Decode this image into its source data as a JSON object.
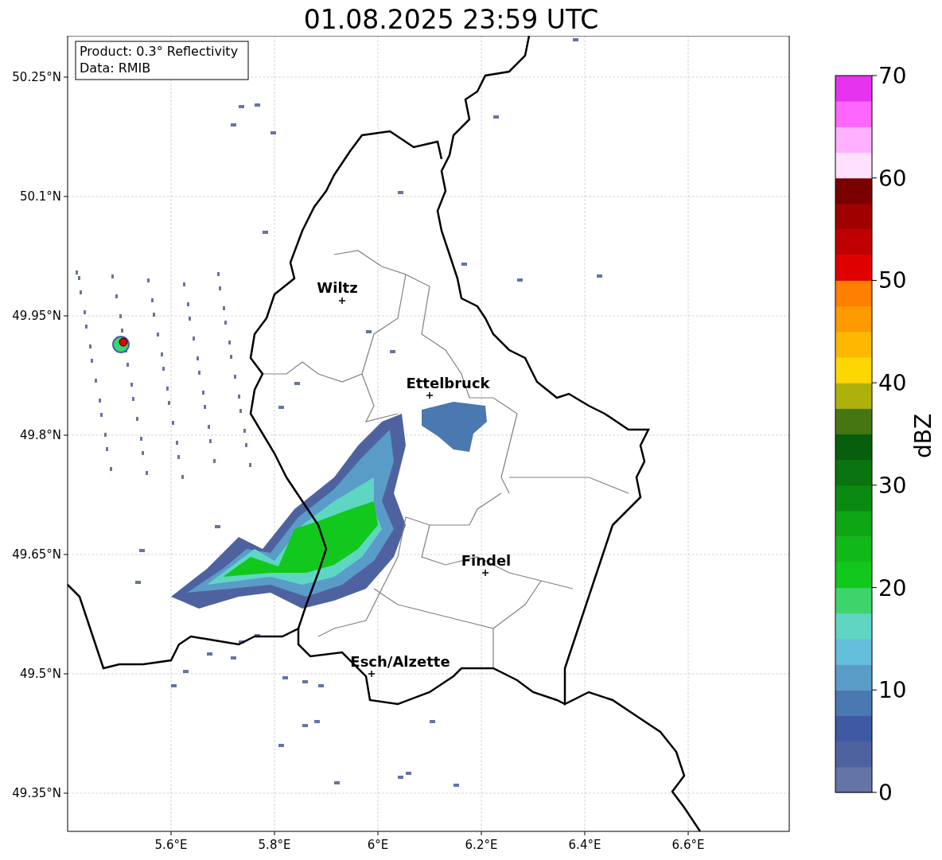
{
  "title": "01.08.2025 23:59 UTC",
  "info_box": {
    "product": "Product: 0.3° Reflectivity",
    "data": "Data: RMIB"
  },
  "y_ticks": [
    "50.25°N",
    "50.1°N",
    "49.95°N",
    "49.8°N",
    "49.65°N",
    "49.5°N",
    "49.35°N"
  ],
  "x_ticks": [
    "5.6°E",
    "5.8°E",
    "6°E",
    "6.2°E",
    "6.4°E",
    "6.6°E"
  ],
  "cities": [
    "Wiltz",
    "Ettelbruck",
    "Findel",
    "Esch/Alzette"
  ],
  "colorbar": {
    "label": "dBZ",
    "ticks": [
      "70",
      "60",
      "50",
      "40",
      "30",
      "20",
      "10",
      "0"
    ],
    "bands": [
      {
        "color": "#6474a6"
      },
      {
        "color": "#4f62a0"
      },
      {
        "color": "#3f5aa3"
      },
      {
        "color": "#4a78b0"
      },
      {
        "color": "#5a9cc8"
      },
      {
        "color": "#64bfdc"
      },
      {
        "color": "#5fd6c4"
      },
      {
        "color": "#3dd46c"
      },
      {
        "color": "#12c81c"
      },
      {
        "color": "#10b81a"
      },
      {
        "color": "#0fa615"
      },
      {
        "color": "#0b8a12"
      },
      {
        "color": "#0a7410"
      },
      {
        "color": "#075e0c"
      },
      {
        "color": "#467611"
      },
      {
        "color": "#adb10a"
      },
      {
        "color": "#ffd700"
      },
      {
        "color": "#ffb800"
      },
      {
        "color": "#ff9a00"
      },
      {
        "color": "#ff7f00"
      },
      {
        "color": "#e00000"
      },
      {
        "color": "#c00000"
      },
      {
        "color": "#a00000"
      },
      {
        "color": "#7a0000"
      },
      {
        "color": "#ffe0ff"
      },
      {
        "color": "#ffb0ff"
      },
      {
        "color": "#ff66ff"
      },
      {
        "color": "#e633f0"
      }
    ]
  }
}
